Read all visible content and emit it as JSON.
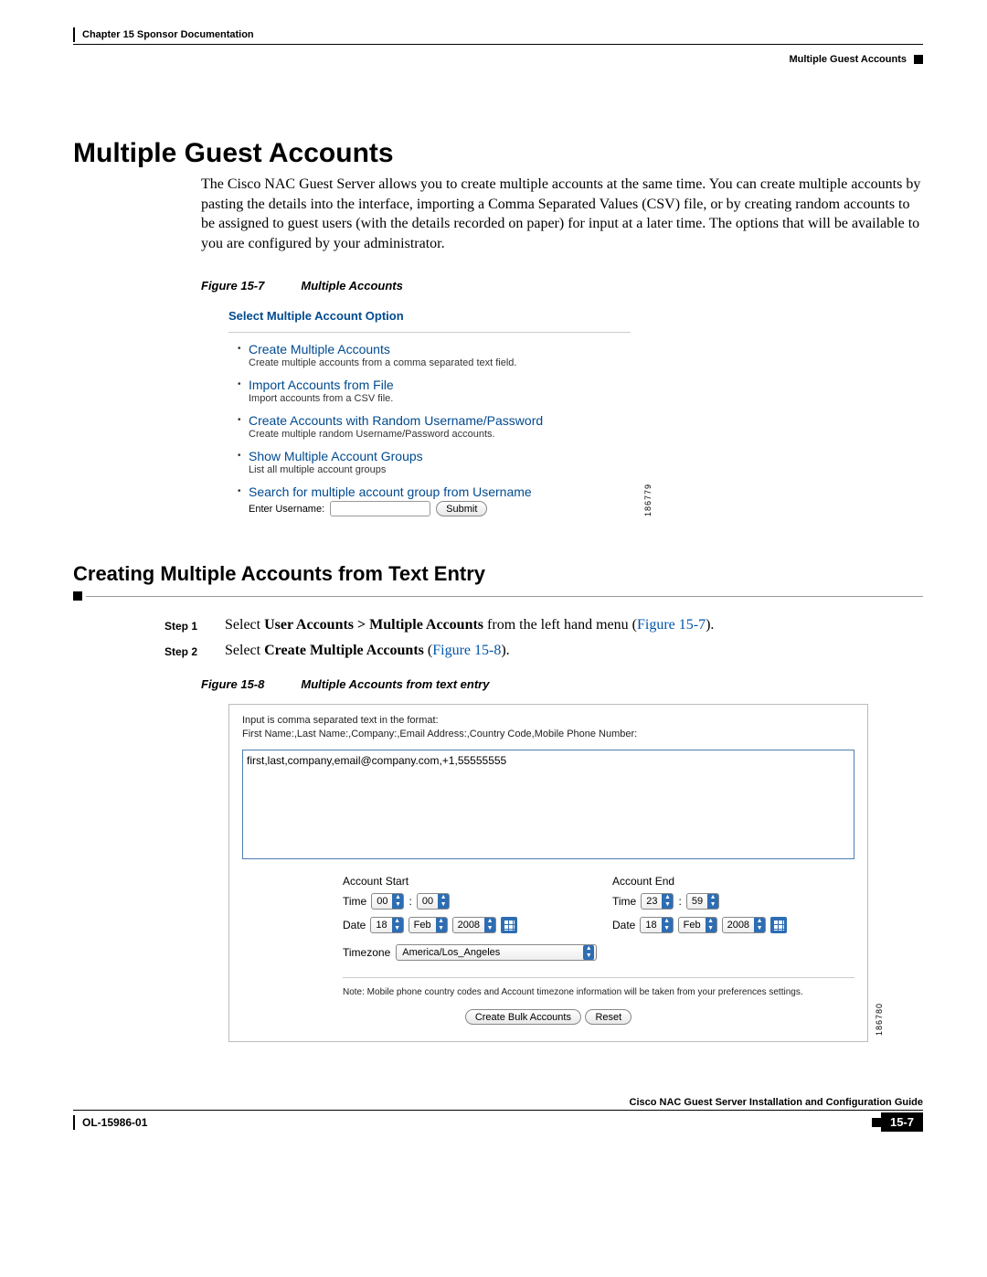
{
  "header": {
    "chapter": "Chapter 15    Sponsor Documentation",
    "section": "Multiple Guest Accounts"
  },
  "h1": "Multiple Guest Accounts",
  "intro": "The Cisco NAC Guest Server allows you to create multiple accounts at the same time. You can create multiple accounts by pasting the details into the interface, importing a Comma Separated Values (CSV) file, or by creating random accounts to be assigned to guest users (with the details recorded on paper) for input at a later time. The options that will be available to you are configured by your administrator.",
  "fig7": {
    "caption_label": "Figure 15-7",
    "caption_title": "Multiple Accounts",
    "panel_title": "Select Multiple Account Option",
    "items": [
      {
        "link": "Create Multiple Accounts",
        "desc": "Create multiple accounts from a comma separated text field."
      },
      {
        "link": "Import Accounts from File",
        "desc": "Import accounts from a CSV file."
      },
      {
        "link": "Create Accounts with Random Username/Password",
        "desc": "Create multiple random Username/Password accounts."
      },
      {
        "link": "Show Multiple Account Groups",
        "desc": "List all multiple account groups"
      },
      {
        "link": "Search for multiple account group from Username",
        "desc": ""
      }
    ],
    "search_label": "Enter Username:",
    "submit_label": "Submit",
    "sideid": "186779"
  },
  "h2": "Creating Multiple Accounts from Text Entry",
  "steps": {
    "s1_label": "Step 1",
    "s1_text_a": "Select ",
    "s1_bold": "User Accounts > Multiple Accounts",
    "s1_text_b": " from the left hand menu (",
    "s1_ref": "Figure 15-7",
    "s1_text_c": ").",
    "s2_label": "Step 2",
    "s2_text_a": "Select ",
    "s2_bold": "Create Multiple Accounts",
    "s2_text_b": " (",
    "s2_ref": "Figure 15-8",
    "s2_text_c": ")."
  },
  "fig8": {
    "caption_label": "Figure 15-8",
    "caption_title": "Multiple Accounts from text entry",
    "hint1": "Input is comma separated text in the format:",
    "hint2": "First Name:,Last Name:,Company:,Email Address:,Country Code,Mobile Phone Number:",
    "textarea_value": "first,last,company,email@company.com,+1,55555555",
    "start_label": "Account Start",
    "end_label": "Account End",
    "time_label": "Time",
    "date_label": "Date",
    "start_time_h": "00",
    "start_time_m": "00",
    "start_date_d": "18",
    "start_date_m": "Feb",
    "start_date_y": "2008",
    "end_time_h": "23",
    "end_time_m": "59",
    "end_date_d": "18",
    "end_date_m": "Feb",
    "end_date_y": "2008",
    "tz_label": "Timezone",
    "tz_value": "America/Los_Angeles",
    "note": "Note: Mobile phone country codes and Account timezone information will be taken from your preferences settings.",
    "btn_create": "Create Bulk Accounts",
    "btn_reset": "Reset",
    "sideid": "186780"
  },
  "footer": {
    "guide": "Cisco NAC Guest Server Installation and Configuration Guide",
    "ol": "OL-15986-01",
    "page": "15-7"
  }
}
